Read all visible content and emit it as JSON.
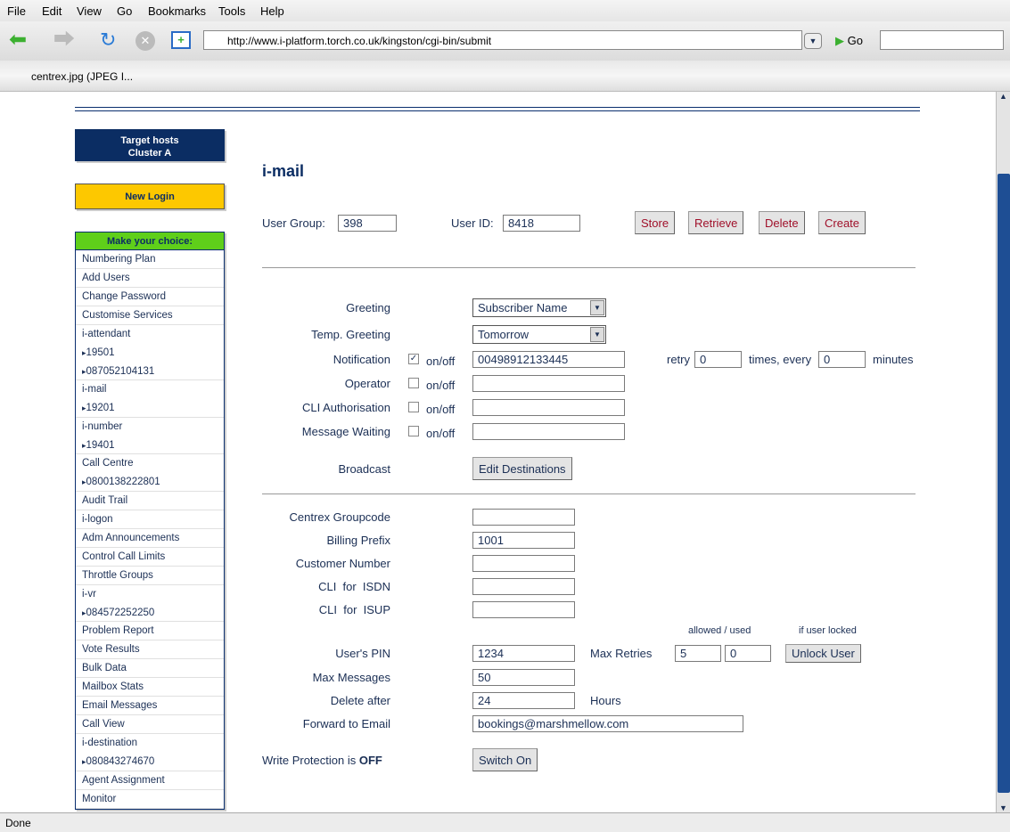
{
  "browser": {
    "menus": [
      "File",
      "Edit",
      "View",
      "Go",
      "Bookmarks",
      "Tools",
      "Help"
    ],
    "url": "http://www.i-platform.torch.co.uk/kingston/cgi-bin/submit",
    "go_label": "Go",
    "tab": "centrex.jpg (JPEG I...",
    "status": "Done"
  },
  "sidebar": {
    "target": "Target hosts",
    "cluster": "Cluster A",
    "new_login": "New Login",
    "nav_header": "Make your choice:",
    "items": [
      {
        "t": "Numbering Plan"
      },
      {
        "t": "Add Users"
      },
      {
        "t": "Change Password"
      },
      {
        "t": "Customise Services"
      },
      {
        "t": "i-attendant"
      },
      {
        "t": "19501",
        "s": 1
      },
      {
        "t": "087052104131",
        "s": 1
      },
      {
        "t": "i-mail"
      },
      {
        "t": "19201",
        "s": 1
      },
      {
        "t": "i-number"
      },
      {
        "t": "19401",
        "s": 1
      },
      {
        "t": "Call Centre"
      },
      {
        "t": "0800138222801",
        "s": 1
      },
      {
        "t": "Audit Trail"
      },
      {
        "t": "i-logon"
      },
      {
        "t": "Adm Announcements"
      },
      {
        "t": "Control Call Limits"
      },
      {
        "t": "Throttle Groups"
      },
      {
        "t": "i-vr"
      },
      {
        "t": "084572252250",
        "s": 1
      },
      {
        "t": "Problem Report"
      },
      {
        "t": "Vote Results"
      },
      {
        "t": "Bulk Data"
      },
      {
        "t": "Mailbox Stats"
      },
      {
        "t": "Email Messages"
      },
      {
        "t": "Call View"
      },
      {
        "t": "i-destination"
      },
      {
        "t": "080843274670",
        "s": 1
      },
      {
        "t": "Agent Assignment"
      },
      {
        "t": "Monitor"
      }
    ]
  },
  "main": {
    "title": "i-mail",
    "user_group_label": "User Group:",
    "user_group": "398",
    "user_id_label": "User ID:",
    "user_id": "8418",
    "buttons": {
      "store": "Store",
      "retrieve": "Retrieve",
      "delete": "Delete",
      "create": "Create",
      "edit_dest": "Edit Destinations",
      "unlock": "Unlock User",
      "switch_on": "Switch On"
    },
    "greeting_label": "Greeting",
    "greeting": "Subscriber Name",
    "temp_greeting_label": "Temp. Greeting",
    "temp_greeting": "Tomorrow",
    "onoff": "on/off",
    "notification_label": "Notification",
    "notification": "00498912133445",
    "retry_label": "retry",
    "retry": "0",
    "times_label": "times, every",
    "every": "0",
    "minutes_label": "minutes",
    "operator_label": "Operator",
    "cli_auth_label": "CLI Authorisation",
    "msg_wait_label": "Message Waiting",
    "broadcast_label": "Broadcast",
    "centrex_label": "Centrex Groupcode",
    "billing_label": "Billing Prefix",
    "billing": "1001",
    "customer_label": "Customer Number",
    "cli_isdn_label": "CLI  for  ISDN",
    "cli_isup_label": "CLI  for  ISUP",
    "allowed_used": "allowed / used",
    "if_locked": "if user locked",
    "pin_label": "User's PIN",
    "pin": "1234",
    "max_retries_label": "Max Retries",
    "max_allowed": "5",
    "max_used": "0",
    "max_msg_label": "Max Messages",
    "max_msg": "50",
    "delete_after_label": "Delete after",
    "delete_after": "24",
    "hours": "Hours",
    "fwd_label": "Forward to Email",
    "fwd": "bookings@marshmellow.com",
    "wp_label": "Write Protection is",
    "wp_state": "OFF"
  }
}
